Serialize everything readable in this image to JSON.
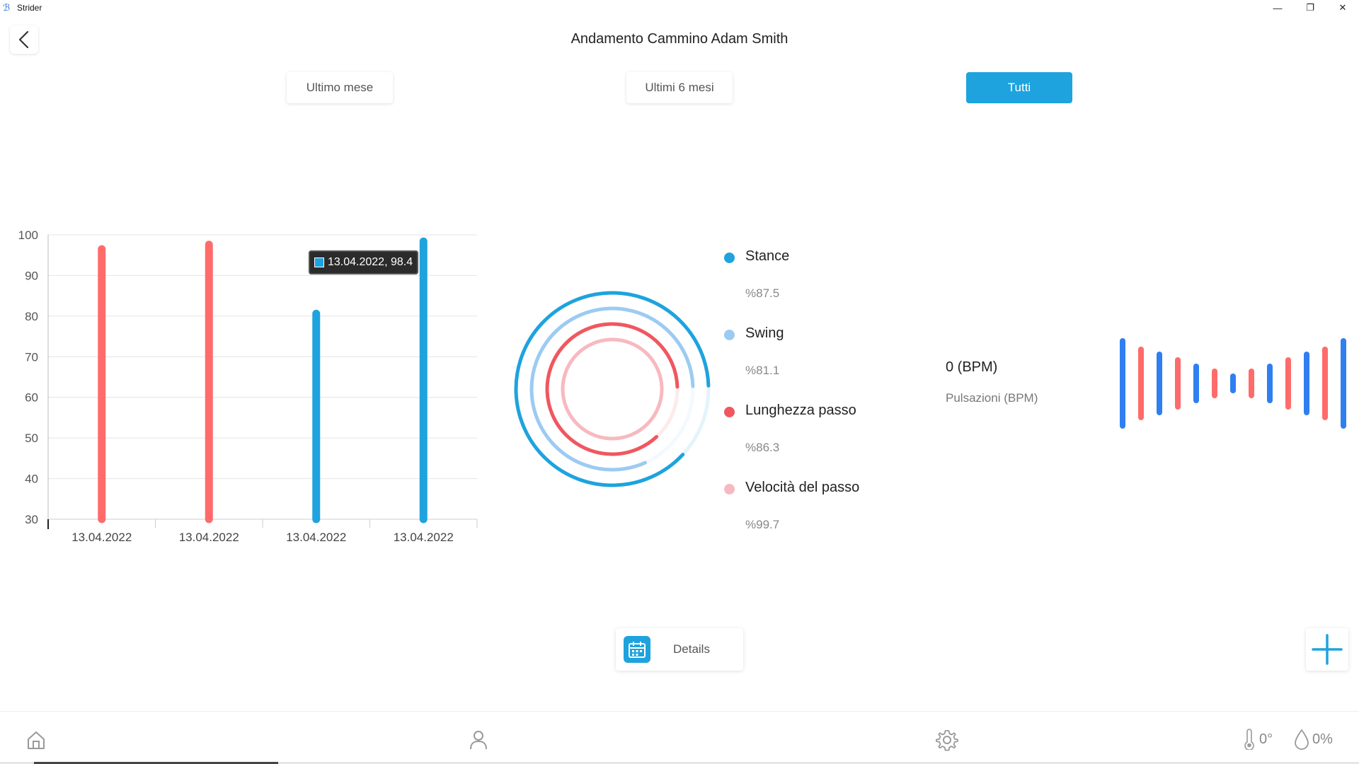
{
  "window": {
    "app_name": "Strider",
    "controls": {
      "minimize": "—",
      "maximize": "❐",
      "close": "✕"
    }
  },
  "header": {
    "title": "Andamento Cammino Adam Smith"
  },
  "filters": [
    {
      "label": "Ultimo mese",
      "active": false
    },
    {
      "label": "Ultimi 6 mesi",
      "active": false
    },
    {
      "label": "Tutti",
      "active": true
    }
  ],
  "chart_data": {
    "type": "bar",
    "categories": [
      "13.04.2022",
      "13.04.2022",
      "13.04.2022",
      "13.04.2022"
    ],
    "values": [
      96.5,
      97.6,
      80.6,
      98.4
    ],
    "colors": [
      "#ff6b6b",
      "#ff6b6b",
      "#1ea3de",
      "#1ea3de"
    ],
    "ylim": [
      30,
      100
    ],
    "yticks": [
      30,
      40,
      50,
      60,
      70,
      80,
      90,
      100
    ],
    "grid": true,
    "tooltip": "13.04.2022, 98.4"
  },
  "legend": [
    {
      "label": "Stance",
      "value": "%87.5",
      "color": "#1ea3de"
    },
    {
      "label": "Swing",
      "value": "%81.1",
      "color": "#9ccbf2"
    },
    {
      "label": "Lunghezza passo",
      "value": "%86.3",
      "color": "#f0575f"
    },
    {
      "label": "Velocità del passo",
      "value": "%99.7",
      "color": "#f7b9bf"
    }
  ],
  "rings": [
    {
      "name": "Stance",
      "fraction": 0.875,
      "color": "#1ea3de"
    },
    {
      "name": "Swing",
      "fraction": 0.811,
      "color": "#9ccbf2"
    },
    {
      "name": "Lunghezza passo",
      "fraction": 0.863,
      "color": "#f0575f"
    },
    {
      "name": "Velocità del passo",
      "fraction": 0.997,
      "color": "#f7b9bf"
    }
  ],
  "heart": {
    "value": "0 (BPM)",
    "label": "Pulsazioni (BPM)"
  },
  "details": {
    "label": "Details"
  },
  "bottom_nav": {
    "temperature": "0°",
    "humidity": "0%"
  },
  "colors": {
    "accent": "#1ea3de",
    "red": "#ff6b6b"
  }
}
